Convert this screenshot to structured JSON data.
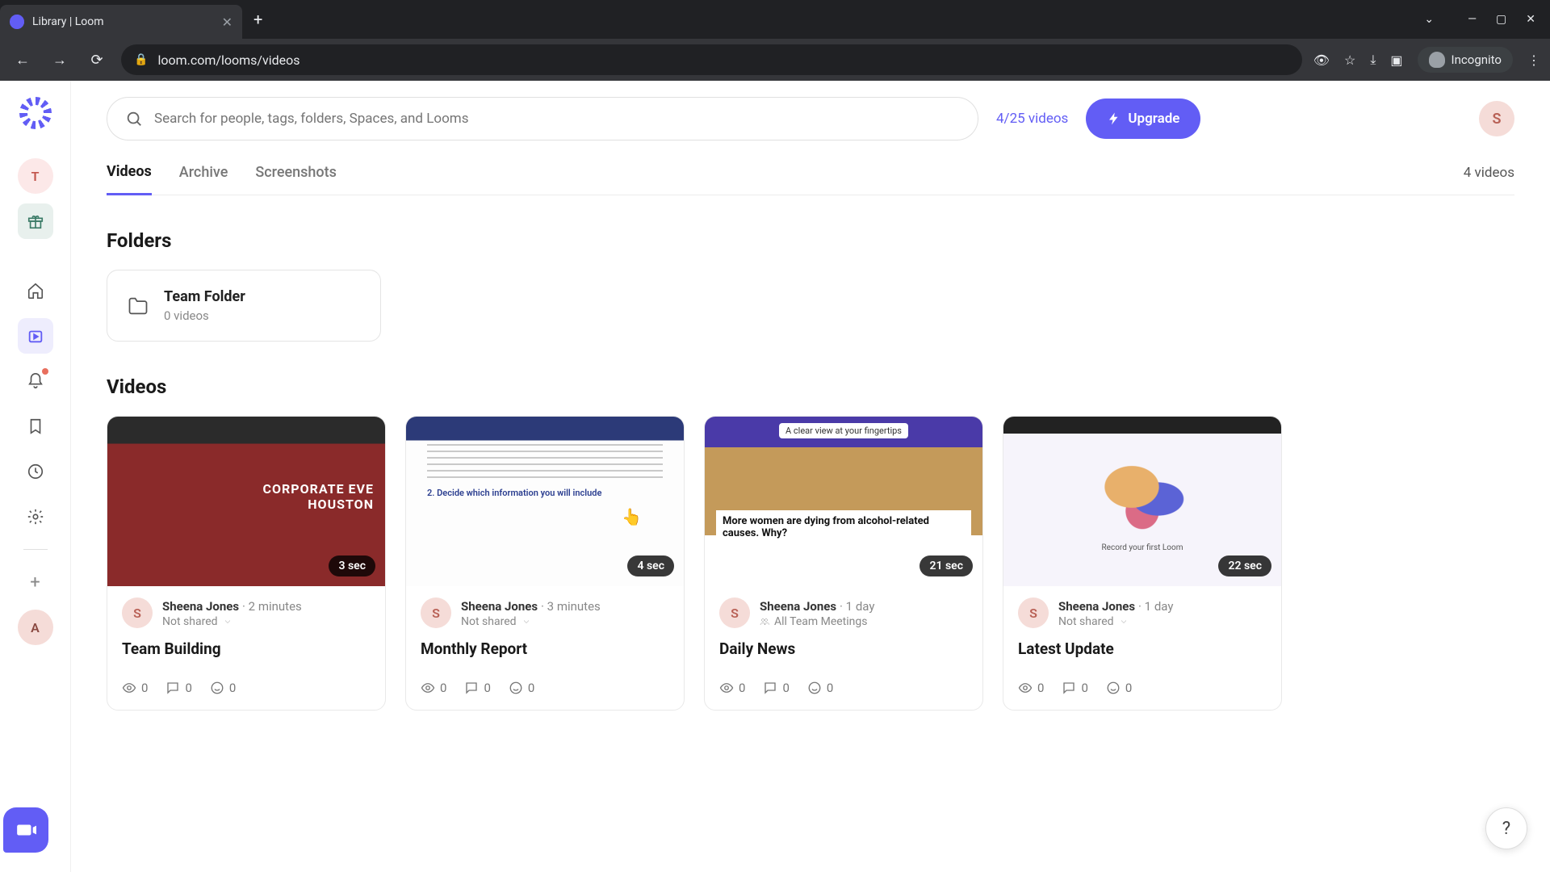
{
  "browser": {
    "tab_title": "Library | Loom",
    "url": "loom.com/looms/videos",
    "incognito_label": "Incognito"
  },
  "sidebar": {
    "workspace_initial": "T",
    "bottom_avatar": "A"
  },
  "header": {
    "search_placeholder": "Search for people, tags, folders, Spaces, and Looms",
    "quota_text": "4/25 videos",
    "upgrade_label": "Upgrade",
    "user_avatar": "S"
  },
  "tabs": {
    "items": [
      {
        "label": "Videos",
        "active": true
      },
      {
        "label": "Archive",
        "active": false
      },
      {
        "label": "Screenshots",
        "active": false
      }
    ],
    "count_text": "4 videos"
  },
  "sections": {
    "folders_heading": "Folders",
    "videos_heading": "Videos"
  },
  "folders": [
    {
      "name": "Team Folder",
      "count": "0 videos"
    }
  ],
  "videos": [
    {
      "title": "Team Building",
      "author": "Sheena Jones",
      "time": "2 minutes",
      "shared": "Not shared",
      "duration": "3 sec",
      "views": "0",
      "comments": "0",
      "reactions": "0",
      "avatar": "S",
      "thumb_overlay": "CORPORATE EVE HOUSTON"
    },
    {
      "title": "Monthly Report",
      "author": "Sheena Jones",
      "time": "3 minutes",
      "shared": "Not shared",
      "duration": "4 sec",
      "views": "0",
      "comments": "0",
      "reactions": "0",
      "avatar": "S",
      "thumb_text": "2. Decide which information you will include"
    },
    {
      "title": "Daily News",
      "author": "Sheena Jones",
      "time": "1 day",
      "shared": "All Team Meetings",
      "duration": "21 sec",
      "views": "0",
      "comments": "0",
      "reactions": "0",
      "avatar": "S",
      "thumb_headline": "More women are dying from alcohol-related causes. Why?",
      "thumb_banner": "A clear view at your fingertips"
    },
    {
      "title": "Latest Update",
      "author": "Sheena Jones",
      "time": "1 day",
      "shared": "Not shared",
      "duration": "22 sec",
      "views": "0",
      "comments": "0",
      "reactions": "0",
      "avatar": "S",
      "thumb_caption": "Record your first Loom"
    }
  ],
  "help": "?"
}
